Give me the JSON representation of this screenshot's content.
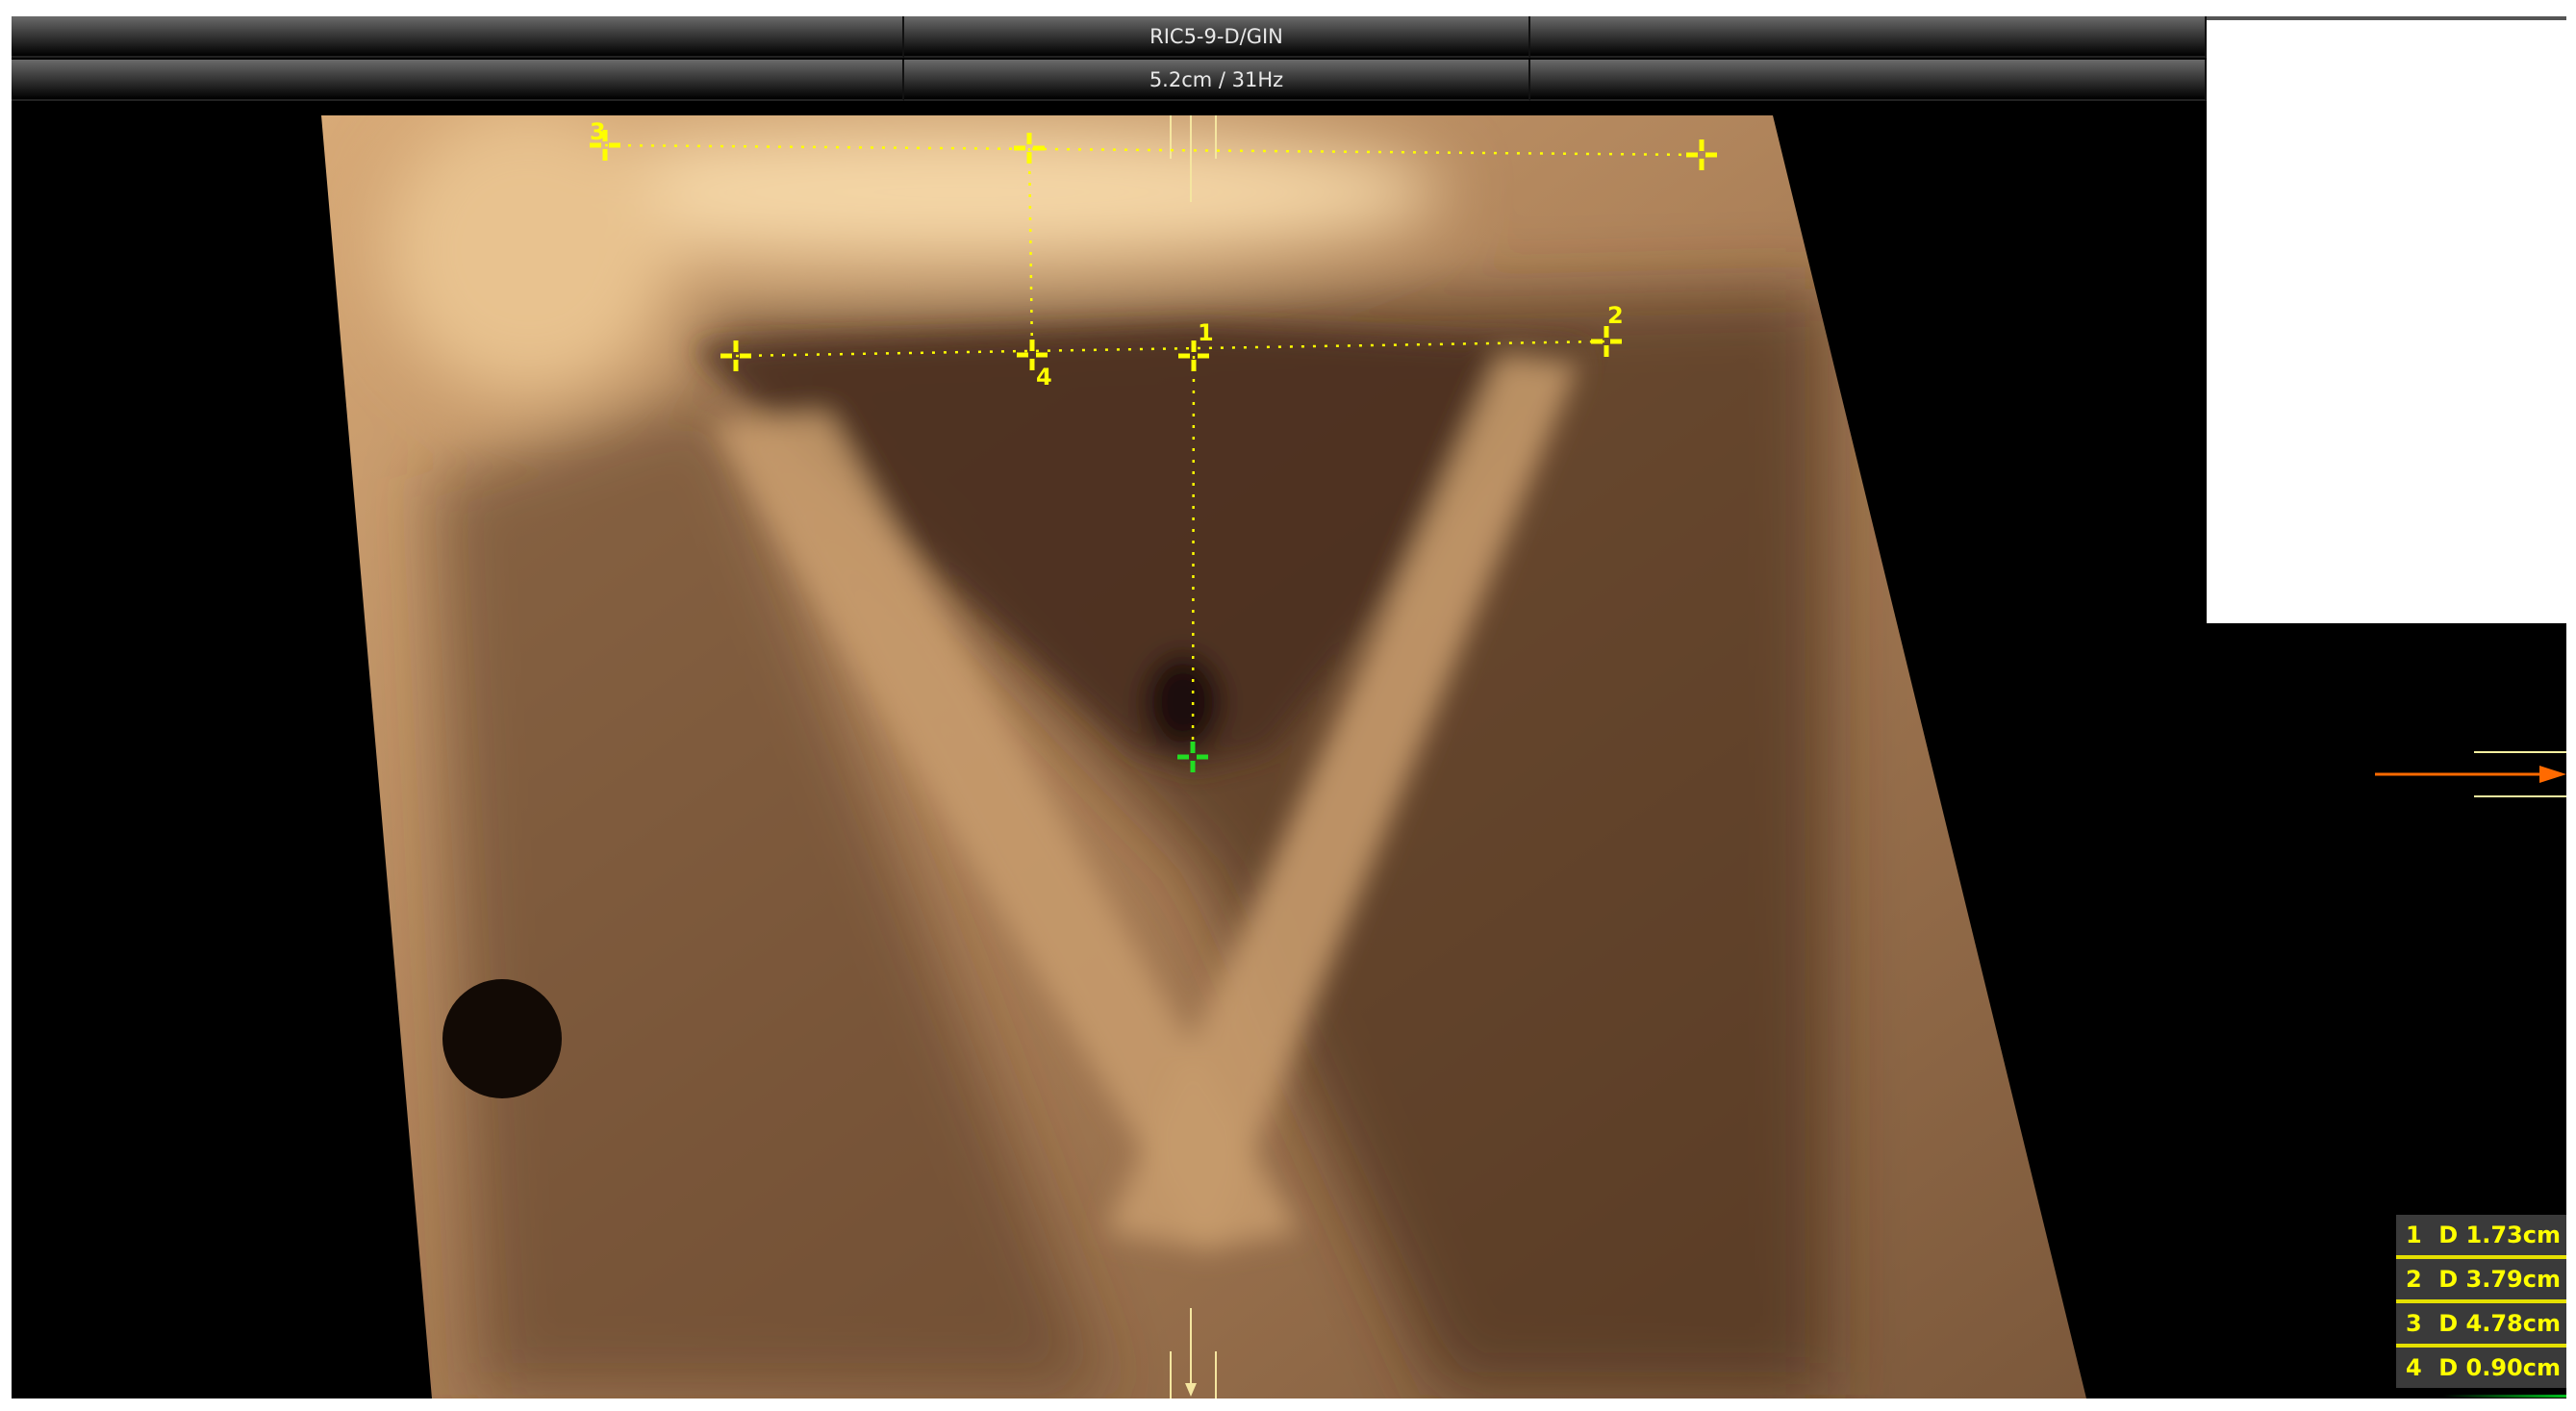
{
  "header": {
    "probe": "RIC5-9-D/GIN",
    "depth_rate": "5.2cm / 31Hz"
  },
  "markers": [
    {
      "id": "1",
      "label": "1"
    },
    {
      "id": "2",
      "label": "2"
    },
    {
      "id": "3",
      "label": "3"
    },
    {
      "id": "4",
      "label": "4"
    }
  ],
  "measurements": [
    {
      "index": "1",
      "value": "D 1.73cm"
    },
    {
      "index": "2",
      "value": "D 3.79cm"
    },
    {
      "index": "3",
      "value": "D 4.78cm"
    },
    {
      "index": "4",
      "value": "D 0.90cm"
    }
  ],
  "colors": {
    "caliper": "#ffff00",
    "active_caliper": "#22dd22",
    "orientation_arrow": "#ff6a00",
    "tissue": "#b8895a"
  }
}
